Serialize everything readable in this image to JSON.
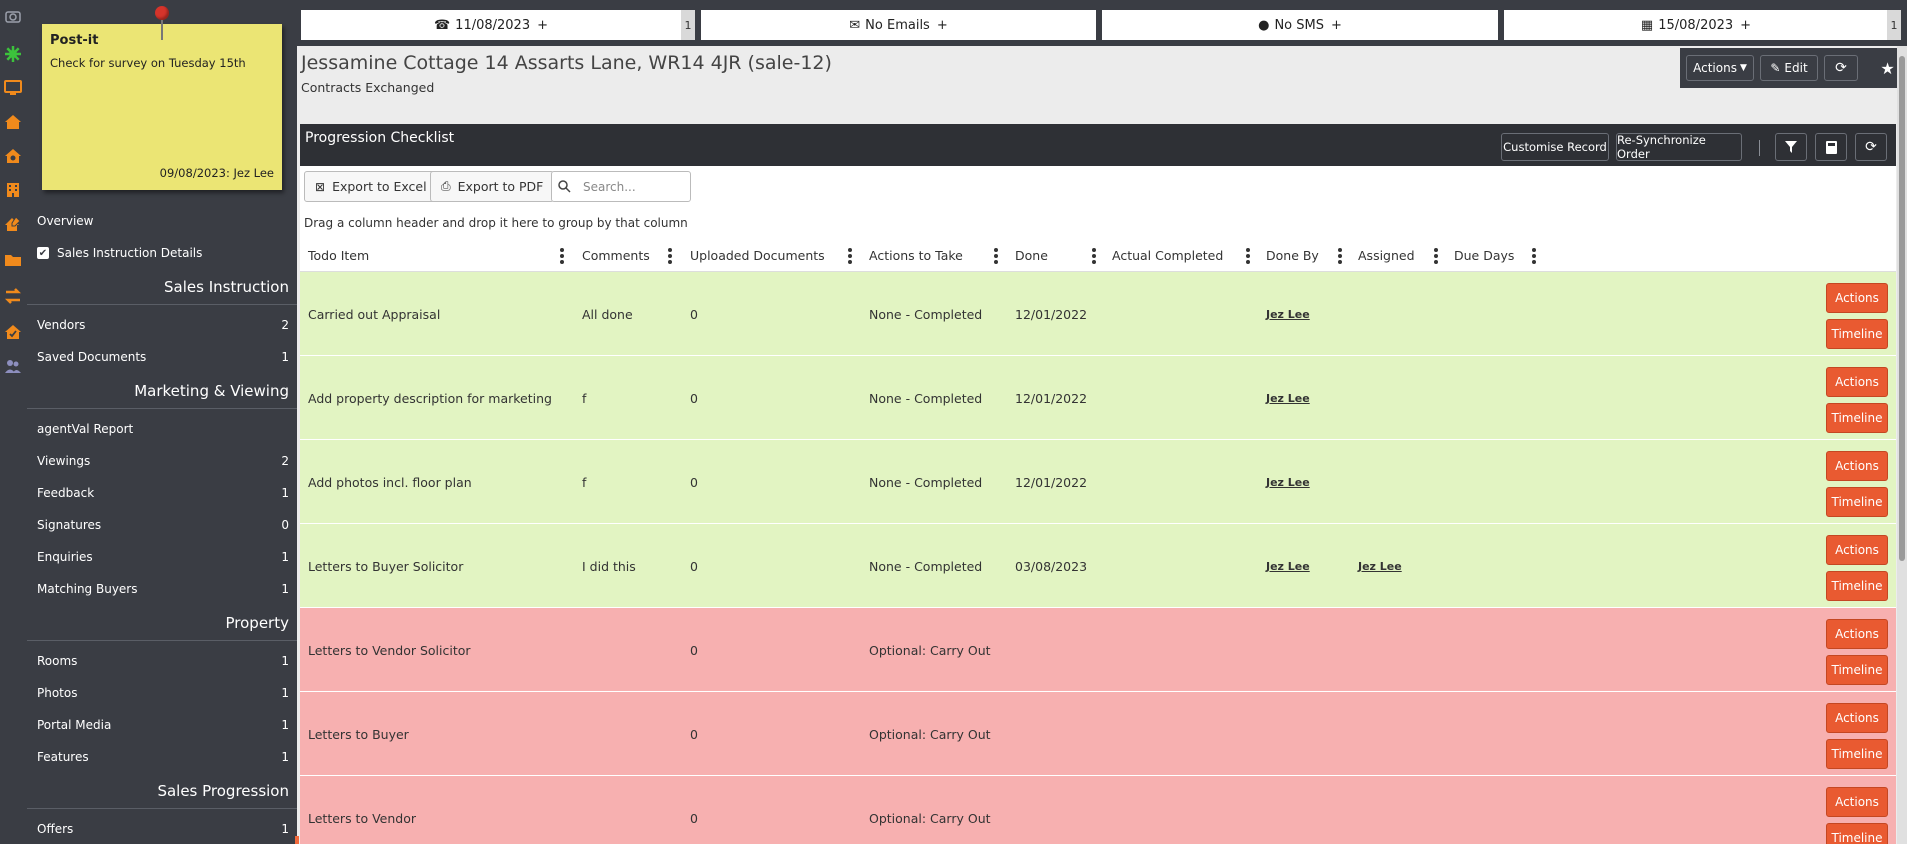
{
  "colors": {
    "sidebar_bg": "#3a3d44",
    "postit_bg": "#ebe574",
    "row_done": "#e2f4c2",
    "row_pending": "#f7b0b0",
    "action_button": "#e95a31",
    "rail_orange": "#f08a1c",
    "rail_green": "#3cc23c"
  },
  "rail": {
    "icons": [
      "camera-icon",
      "cog-icon",
      "monitor-icon",
      "house-icon",
      "house-camera-icon",
      "building-icon",
      "house-pen-icon",
      "folder-icon",
      "transfer-icon",
      "house-check-icon",
      "users-icon"
    ]
  },
  "postit": {
    "title": "Post-it",
    "body": "Check for survey on Tuesday 15th",
    "footer": "09/08/2023: Jez Lee"
  },
  "sidebar": {
    "overview": "Overview",
    "sales_instruction_details": "Sales Instruction Details",
    "sections": [
      {
        "title": "Sales Instruction",
        "items": [
          {
            "label": "Vendors",
            "count": "2"
          },
          {
            "label": "Saved Documents",
            "count": "1"
          }
        ]
      },
      {
        "title": "Marketing & Viewing",
        "items": [
          {
            "label": "agentVal Report",
            "count": ""
          },
          {
            "label": "Viewings",
            "count": "2"
          },
          {
            "label": "Feedback",
            "count": "1"
          },
          {
            "label": "Signatures",
            "count": "0"
          },
          {
            "label": "Enquiries",
            "count": "1"
          },
          {
            "label": "Matching Buyers",
            "count": "1"
          }
        ]
      },
      {
        "title": "Property",
        "items": [
          {
            "label": "Rooms",
            "count": "1"
          },
          {
            "label": "Photos",
            "count": "1"
          },
          {
            "label": "Portal Media",
            "count": "1"
          },
          {
            "label": "Features",
            "count": "1"
          }
        ]
      },
      {
        "title": "Sales Progression",
        "items": [
          {
            "label": "Offers",
            "count": "1"
          }
        ]
      }
    ]
  },
  "toptabs": {
    "call": {
      "label": "11/08/2023",
      "plus": "+",
      "count": "1"
    },
    "email": {
      "label": "No Emails",
      "plus": "+"
    },
    "sms": {
      "label": "No SMS",
      "plus": "+"
    },
    "calendar": {
      "label": "15/08/2023",
      "plus": "+",
      "count": "1"
    }
  },
  "property": {
    "title": "Jessamine Cottage 14 Assarts Lane, WR14 4JR (sale-12)",
    "status": "Contracts Exchanged"
  },
  "header_actions": {
    "actions": "Actions",
    "edit": "Edit"
  },
  "checklist": {
    "title": "Progression Checklist",
    "customise": "Customise Record",
    "resync": "Re-Synchronize Order",
    "export_excel": "Export to Excel",
    "export_pdf": "Export to PDF",
    "search_placeholder": "Search...",
    "group_hint": "Drag a column header and drop it here to group by that column",
    "columns": [
      "Todo Item",
      "Comments",
      "Uploaded Documents",
      "Actions to Take",
      "Done",
      "Actual Completed",
      "Done By",
      "Assigned",
      "Due Days"
    ],
    "actions_label": "Actions",
    "timeline_label": "Timeline",
    "rows": [
      {
        "todo": "Carried out Appraisal",
        "comments": "All done",
        "uploaded": "0",
        "actions_to_take": "None - Completed",
        "done": "12/01/2022",
        "actual": "",
        "done_by": "Jez Lee",
        "assigned": "",
        "due_days": "",
        "status": "done"
      },
      {
        "todo": "Add property description for marketing",
        "comments": "f",
        "uploaded": "0",
        "actions_to_take": "None - Completed",
        "done": "12/01/2022",
        "actual": "",
        "done_by": "Jez Lee",
        "assigned": "",
        "due_days": "",
        "status": "done"
      },
      {
        "todo": "Add photos incl. floor plan",
        "comments": "f",
        "uploaded": "0",
        "actions_to_take": "None - Completed",
        "done": "12/01/2022",
        "actual": "",
        "done_by": "Jez Lee",
        "assigned": "",
        "due_days": "",
        "status": "done"
      },
      {
        "todo": "Letters to Buyer Solicitor",
        "comments": "I did this",
        "uploaded": "0",
        "actions_to_take": "None - Completed",
        "done": "03/08/2023",
        "actual": "",
        "done_by": "Jez Lee",
        "assigned": "Jez Lee",
        "due_days": "",
        "status": "done"
      },
      {
        "todo": "Letters to Vendor Solicitor",
        "comments": "",
        "uploaded": "0",
        "actions_to_take": "Optional: Carry Out",
        "done": "",
        "actual": "",
        "done_by": "",
        "assigned": "",
        "due_days": "",
        "status": "pending"
      },
      {
        "todo": "Letters to Buyer",
        "comments": "",
        "uploaded": "0",
        "actions_to_take": "Optional: Carry Out",
        "done": "",
        "actual": "",
        "done_by": "",
        "assigned": "",
        "due_days": "",
        "status": "pending"
      },
      {
        "todo": "Letters to Vendor",
        "comments": "",
        "uploaded": "0",
        "actions_to_take": "Optional: Carry Out",
        "done": "",
        "actual": "",
        "done_by": "",
        "assigned": "",
        "due_days": "",
        "status": "pending"
      }
    ]
  }
}
